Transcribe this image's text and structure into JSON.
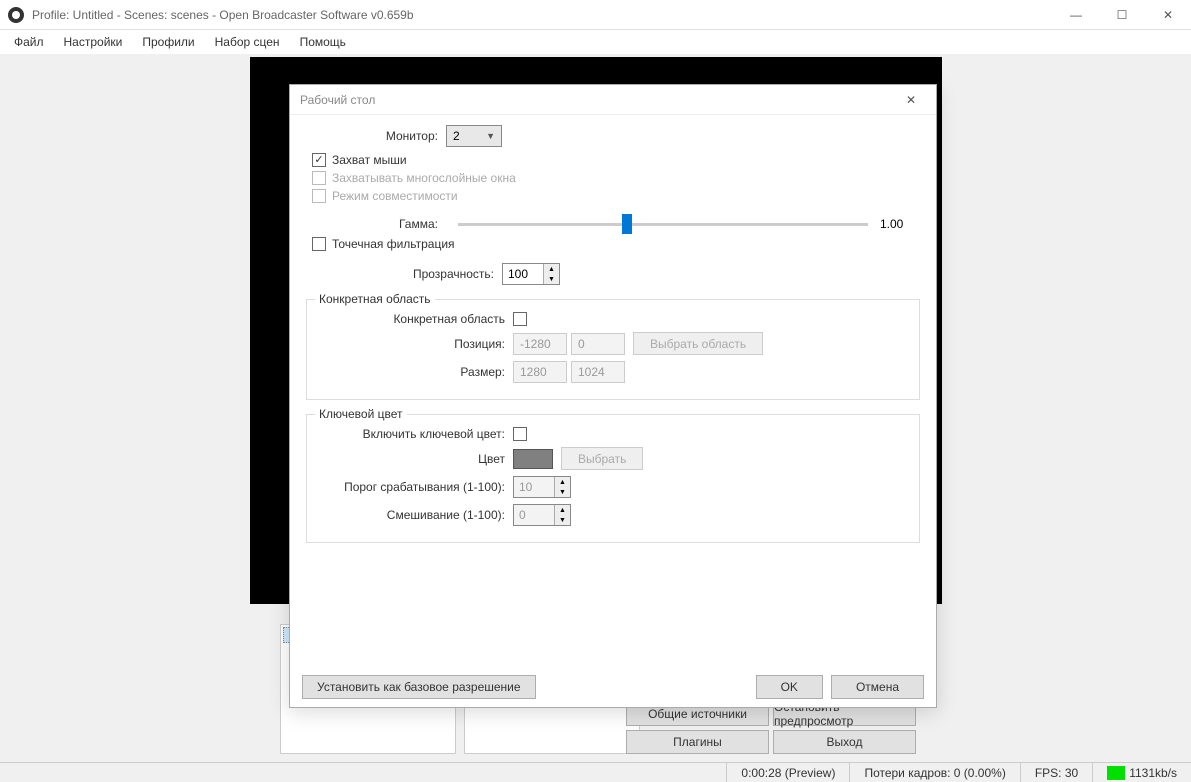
{
  "titlebar": {
    "title": "Profile: Untitled - Scenes: scenes - Open Broadcaster Software v0.659b"
  },
  "menubar": {
    "items": [
      "Файл",
      "Настройки",
      "Профили",
      "Набор сцен",
      "Помощь"
    ]
  },
  "bottom_buttons": {
    "global_sources": "Общие источники",
    "stop_preview": "Остановить предпросмотр",
    "plugins": "Плагины",
    "exit": "Выход"
  },
  "statusbar": {
    "time": "0:00:28 (Preview)",
    "dropped": "Потери кадров: 0 (0.00%)",
    "fps": "FPS: 30",
    "bitrate": "1131kb/s"
  },
  "dialog": {
    "title": "Рабочий стол",
    "monitor_label": "Монитор:",
    "monitor_value": "2",
    "capture_mouse": "Захват мыши",
    "capture_layered": "Захватывать многослойные окна",
    "compat_mode": "Режим совместимости",
    "gamma_label": "Гамма:",
    "gamma_value": "1.00",
    "point_filter": "Точечная фильтрация",
    "opacity_label": "Прозрачность:",
    "opacity_value": "100",
    "region": {
      "legend": "Конкретная область",
      "enable_label": "Конкретная область",
      "pos_label": "Позиция:",
      "pos_x": "-1280",
      "pos_y": "0",
      "select_btn": "Выбрать область",
      "size_label": "Размер:",
      "size_w": "1280",
      "size_h": "1024"
    },
    "chroma": {
      "legend": "Ключевой цвет",
      "enable_label": "Включить ключевой цвет:",
      "color_label": "Цвет",
      "select_btn": "Выбрать",
      "threshold_label": "Порог срабатывания (1-100):",
      "threshold_value": "10",
      "blend_label": "Смешивание (1-100):",
      "blend_value": "0"
    },
    "set_base_res": "Установить как базовое разрешение",
    "ok": "OK",
    "cancel": "Отмена"
  }
}
